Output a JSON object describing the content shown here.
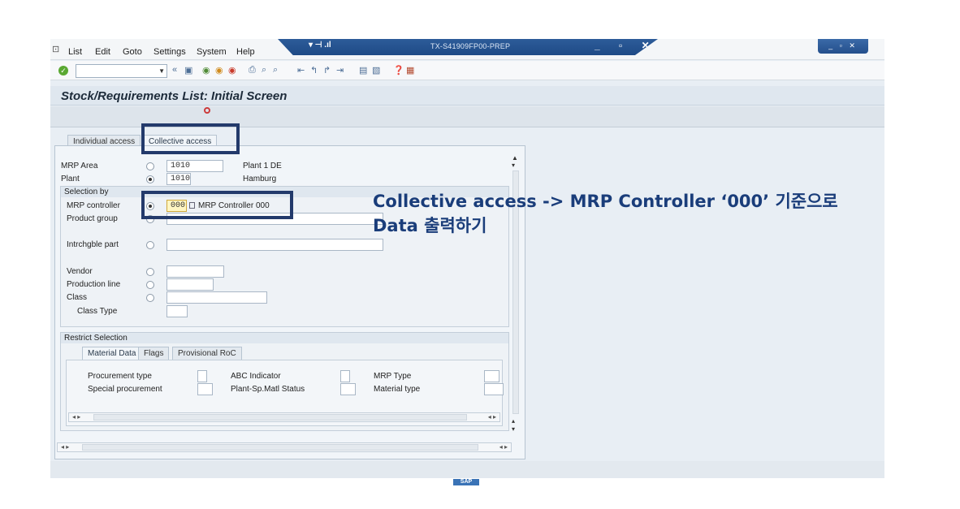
{
  "menu": {
    "items": [
      "List",
      "Edit",
      "Goto",
      "Settings",
      "System",
      "Help"
    ]
  },
  "titlebar": {
    "system": "TX-S41909FP00-PREP"
  },
  "toolbar": {
    "command_value": ""
  },
  "page": {
    "title": "Stock/Requirements List: Initial Screen"
  },
  "tabs": {
    "individual": "Individual access",
    "collective": "Collective access"
  },
  "fields": {
    "mrp_area": {
      "label": "MRP Area",
      "value": "1010",
      "desc": "Plant 1 DE"
    },
    "plant": {
      "label": "Plant",
      "value": "1010",
      "desc": "Hamburg"
    }
  },
  "selection": {
    "title": "Selection by",
    "mrp_controller": {
      "label": "MRP controller",
      "value": "000",
      "desc": "MRP Controller 000"
    },
    "product_group": {
      "label": "Product group"
    },
    "interchangeable": {
      "label": "Intrchgble part"
    },
    "vendor": {
      "label": "Vendor"
    },
    "production_line": {
      "label": "Production line"
    },
    "class": {
      "label": "Class"
    },
    "class_type": {
      "label": "Class Type"
    }
  },
  "restrict": {
    "title": "Restrict Selection",
    "tabs": [
      "Material Data",
      "Flags",
      "Provisional RoC"
    ],
    "procurement_type": "Procurement type",
    "special_procurement": "Special procurement",
    "abc_indicator": "ABC Indicator",
    "plant_sp_status": "Plant-Sp.Matl Status",
    "mrp_type": "MRP Type",
    "material_type": "Material type"
  },
  "annotation": {
    "line1": "Collective access -> MRP Controller ‘000’ 기준으로",
    "line2": "Data 출력하기"
  },
  "status": {
    "logo": "SAP"
  },
  "colors": {
    "highlight_box": "#233a6b",
    "annotation_text": "#1a3d7a",
    "title_bar": "#2d5c9a"
  }
}
